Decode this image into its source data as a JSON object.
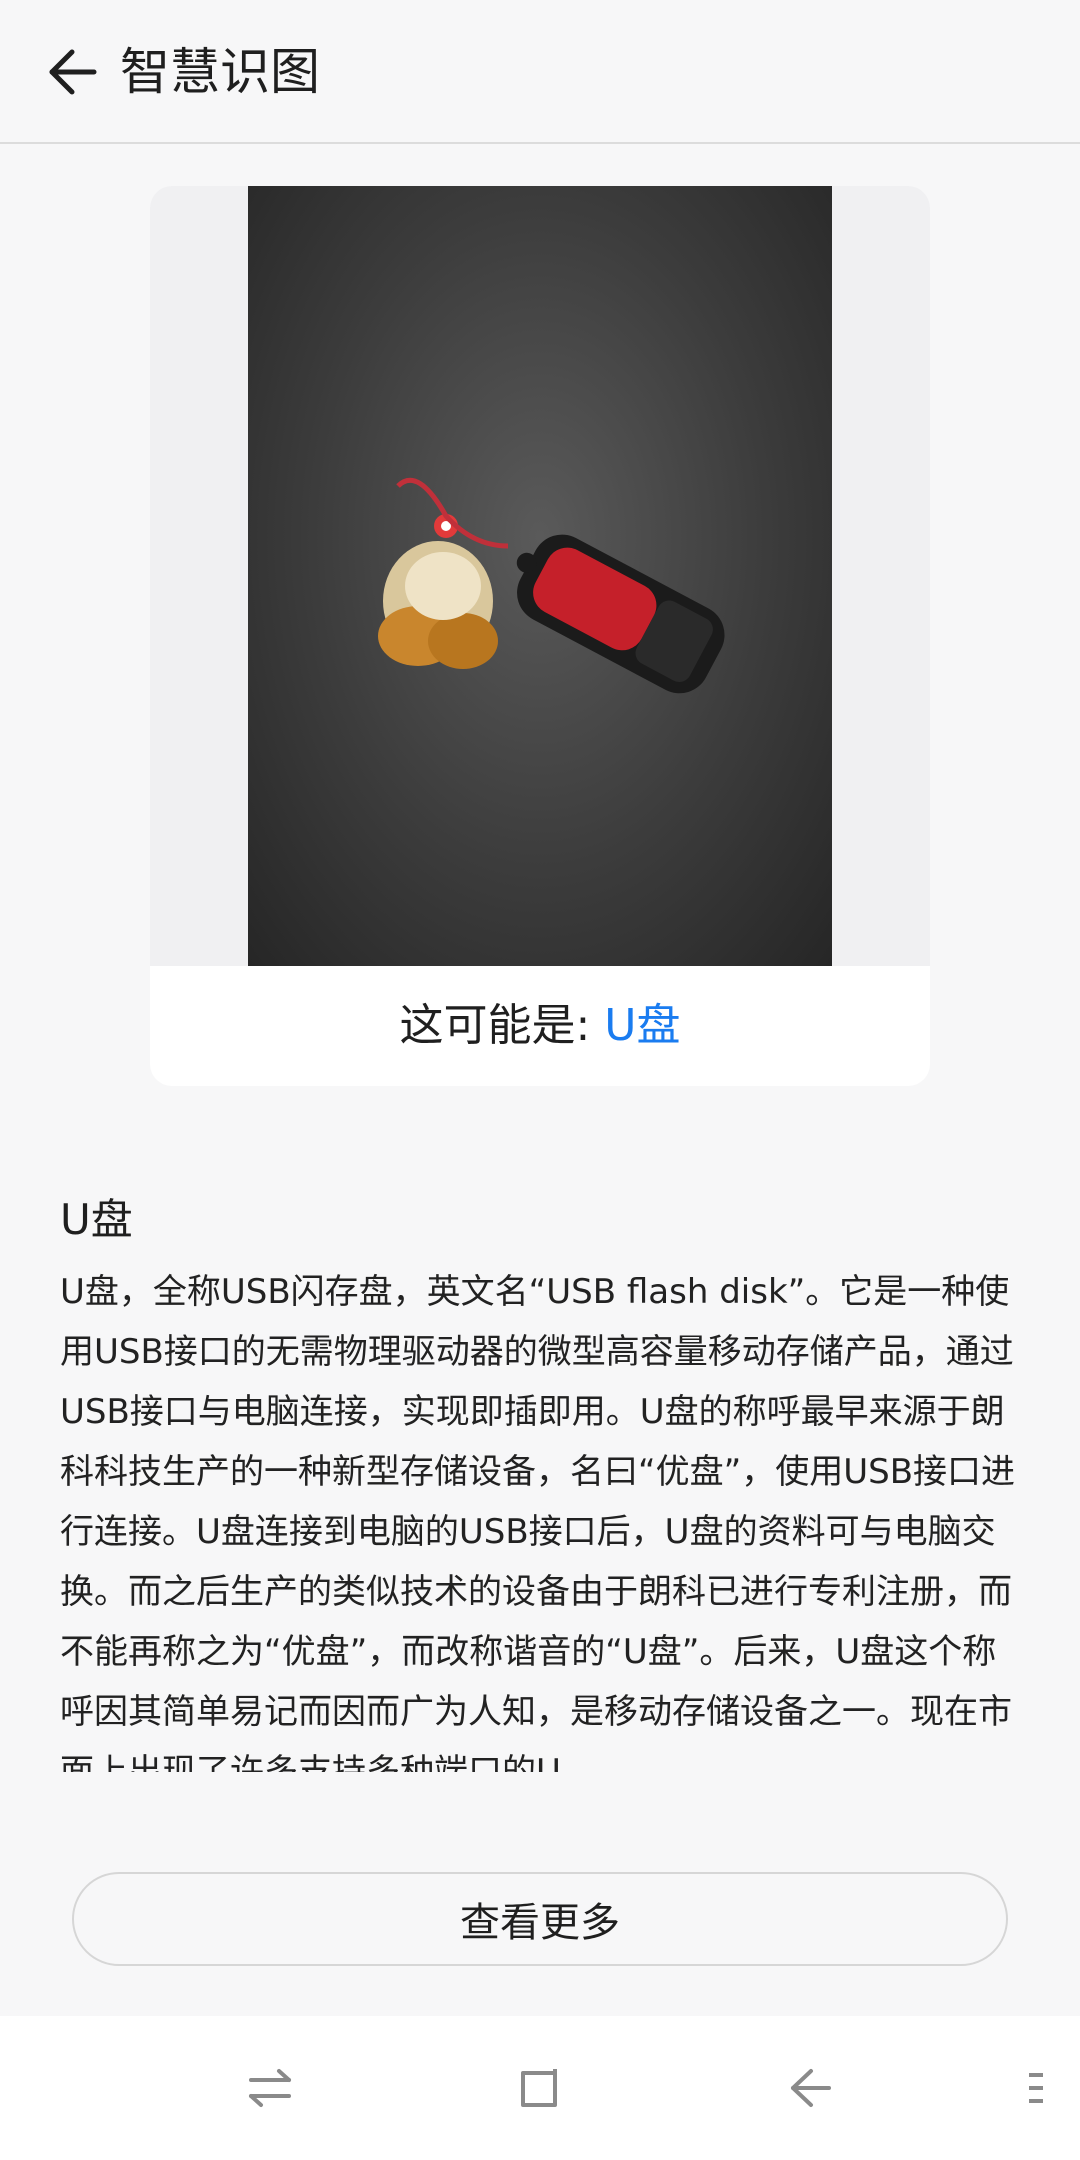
{
  "header": {
    "title": "智慧识图"
  },
  "result": {
    "prefix": "这可能是: ",
    "value": "U盘"
  },
  "article": {
    "title": "U盘",
    "body": "U盘，全称USB闪存盘，英文名“USB flash disk”。它是一种使用USB接口的无需物理驱动器的微型高容量移动存储产品，通过USB接口与电脑连接，实现即插即用。U盘的称呼最早来源于朗科科技生产的一种新型存储设备，名曰“优盘”，使用USB接口进行连接。U盘连接到电脑的USB接口后，U盘的资料可与电脑交换。而之后生产的类似技术的设备由于朗科已进行专利注册，而不能再称之为“优盘”，而改称谐音的“U盘”。后来，U盘这个称呼因其简单易记而因而广为人知，是移动存储设备之一。现在市面上出现了许多支持多种端口的U"
  },
  "actions": {
    "more_label": "查看更多"
  },
  "icons": {
    "back": "arrow-left-icon",
    "nav_switch": "swap-arrows-icon",
    "nav_home": "square-icon",
    "nav_back": "triangle-back-icon",
    "nav_menu": "menu-dots-icon"
  },
  "colors": {
    "accent": "#1a7cf0",
    "background": "#f7f7f8"
  }
}
